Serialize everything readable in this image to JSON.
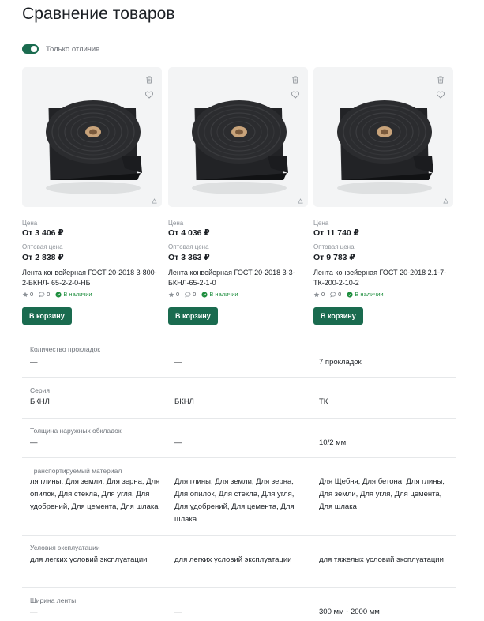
{
  "page": {
    "title": "Сравнение товаров"
  },
  "filter": {
    "only_differences_label": "Только отличия",
    "only_differences_on": true
  },
  "accent_color": "#1a6b4f",
  "in_stock_color": "#1e8e3e",
  "labels": {
    "price": "Цена",
    "wholesale_price": "Оптовая цена",
    "add_to_cart": "В корзину"
  },
  "products": [
    {
      "price": "От 3 406 ₽",
      "wholesale_price": "От 2 838 ₽",
      "name": "Лента конвейерная ГОСТ 20-2018 3-800-2-БКНЛ- 65-2-2-0-НБ",
      "rating": "0",
      "reviews": "0",
      "stock": "В наличии"
    },
    {
      "price": "От 4 036 ₽",
      "wholesale_price": "От 3 363 ₽",
      "name": "Лента конвейерная ГОСТ 20-2018 3-3-БКНЛ-65-2-1-0",
      "rating": "0",
      "reviews": "0",
      "stock": "В наличии"
    },
    {
      "price": "От 11 740 ₽",
      "wholesale_price": "От 9 783 ₽",
      "name": "Лента конвейерная ГОСТ 20-2018 2.1-7-ТК-200-2-10-2",
      "rating": "0",
      "reviews": "0",
      "stock": "В наличии"
    }
  ],
  "specs": [
    {
      "label": "Количество прокладок",
      "values": [
        "—",
        "—",
        "7 прокладок"
      ]
    },
    {
      "label": "Серия",
      "values": [
        "БКНЛ",
        "БКНЛ",
        "ТК"
      ]
    },
    {
      "label": "Толщина наружных обкладок",
      "values": [
        "—",
        "—",
        "10/2 мм"
      ]
    },
    {
      "label": "Транспортируемый материал",
      "values": [
        "ля глины, Для земли, Для зерна, Для опилок, Для стекла, Для угля, Для удобрений, Для цемента, Для шлака",
        "Для глины, Для земли, Для зерна, Для опилок, Для стекла, Для угля, Для удобрений, Для цемента, Для шлака",
        "Для Щебня, Для бетона, Для глины, Для земли, Для угля, Для цемента, Для шлака"
      ]
    },
    {
      "label": "Условия эксплуатации",
      "values": [
        "для легких условий эксплуатации",
        "для легких условий эксплуатации",
        "для тяжелых условий эксплуатации"
      ]
    },
    {
      "label": "Ширина ленты",
      "values": [
        "—",
        "—",
        "300 мм - 2000 мм"
      ]
    }
  ]
}
